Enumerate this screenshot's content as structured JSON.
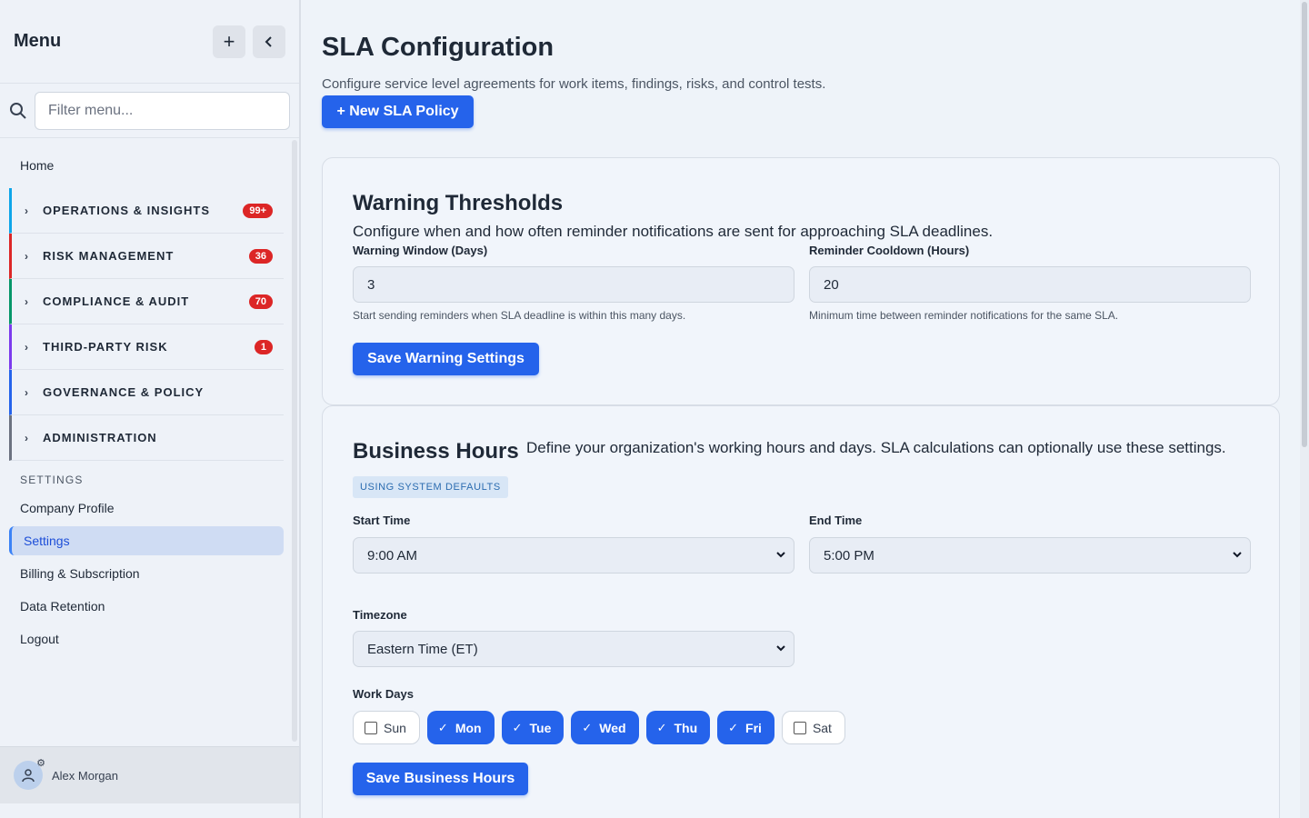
{
  "sidebar": {
    "title": "Menu",
    "add_icon": "plus-icon",
    "collapse_icon": "chevron-left-icon",
    "search": {
      "placeholder": "Filter menu..."
    },
    "home": "Home",
    "groups": [
      {
        "label": "OPERATIONS & INSIGHTS",
        "badge": "99+",
        "color": "#0ea5e9"
      },
      {
        "label": "RISK MANAGEMENT",
        "badge": "36",
        "color": "#dc2626"
      },
      {
        "label": "COMPLIANCE & AUDIT",
        "badge": "70",
        "color": "#059669"
      },
      {
        "label": "THIRD-PARTY RISK",
        "badge": "1",
        "color": "#7c3aed"
      },
      {
        "label": "GOVERNANCE & POLICY",
        "badge": "",
        "color": "#2563eb"
      },
      {
        "label": "ADMINISTRATION",
        "badge": "",
        "color": "#6b7280"
      }
    ],
    "settings_label": "SETTINGS",
    "settings_items": [
      "Company Profile",
      "Settings",
      "Billing & Subscription",
      "Data Retention",
      "Logout"
    ],
    "active_item": "Settings",
    "user": {
      "name": "Alex Morgan"
    }
  },
  "main": {
    "title": "SLA Configuration",
    "subtitle": "Configure service level agreements for work items, findings, risks, and control tests.",
    "new_button": "+ New SLA Policy",
    "warning": {
      "title": "Warning Thresholds",
      "description": "Configure when and how often reminder notifications are sent for approaching SLA deadlines.",
      "window_label": "Warning Window (Days)",
      "window_value": "3",
      "window_hint": "Start sending reminders when SLA deadline is within this many days.",
      "cooldown_label": "Reminder Cooldown (Hours)",
      "cooldown_value": "20",
      "cooldown_hint": "Minimum time between reminder notifications for the same SLA.",
      "save_button": "Save Warning Settings"
    },
    "business_hours": {
      "title": "Business Hours",
      "description": "Define your organization's working hours and days. SLA calculations can optionally use these settings.",
      "defaults_chip": "USING SYSTEM DEFAULTS",
      "start_label": "Start Time",
      "start_value": "9:00 AM",
      "end_label": "End Time",
      "end_value": "5:00 PM",
      "timezone_label": "Timezone",
      "timezone_value": "Eastern Time (ET)",
      "workdays_label": "Work Days",
      "days": [
        {
          "label": "Sun",
          "on": false
        },
        {
          "label": "Mon",
          "on": true
        },
        {
          "label": "Tue",
          "on": true
        },
        {
          "label": "Wed",
          "on": true
        },
        {
          "label": "Thu",
          "on": true
        },
        {
          "label": "Fri",
          "on": true
        },
        {
          "label": "Sat",
          "on": false
        }
      ],
      "save_button": "Save Business Hours"
    }
  },
  "colors": {
    "accent": "#2563eb",
    "badge": "#dc2626",
    "active_bg": "#cfdcf3"
  }
}
